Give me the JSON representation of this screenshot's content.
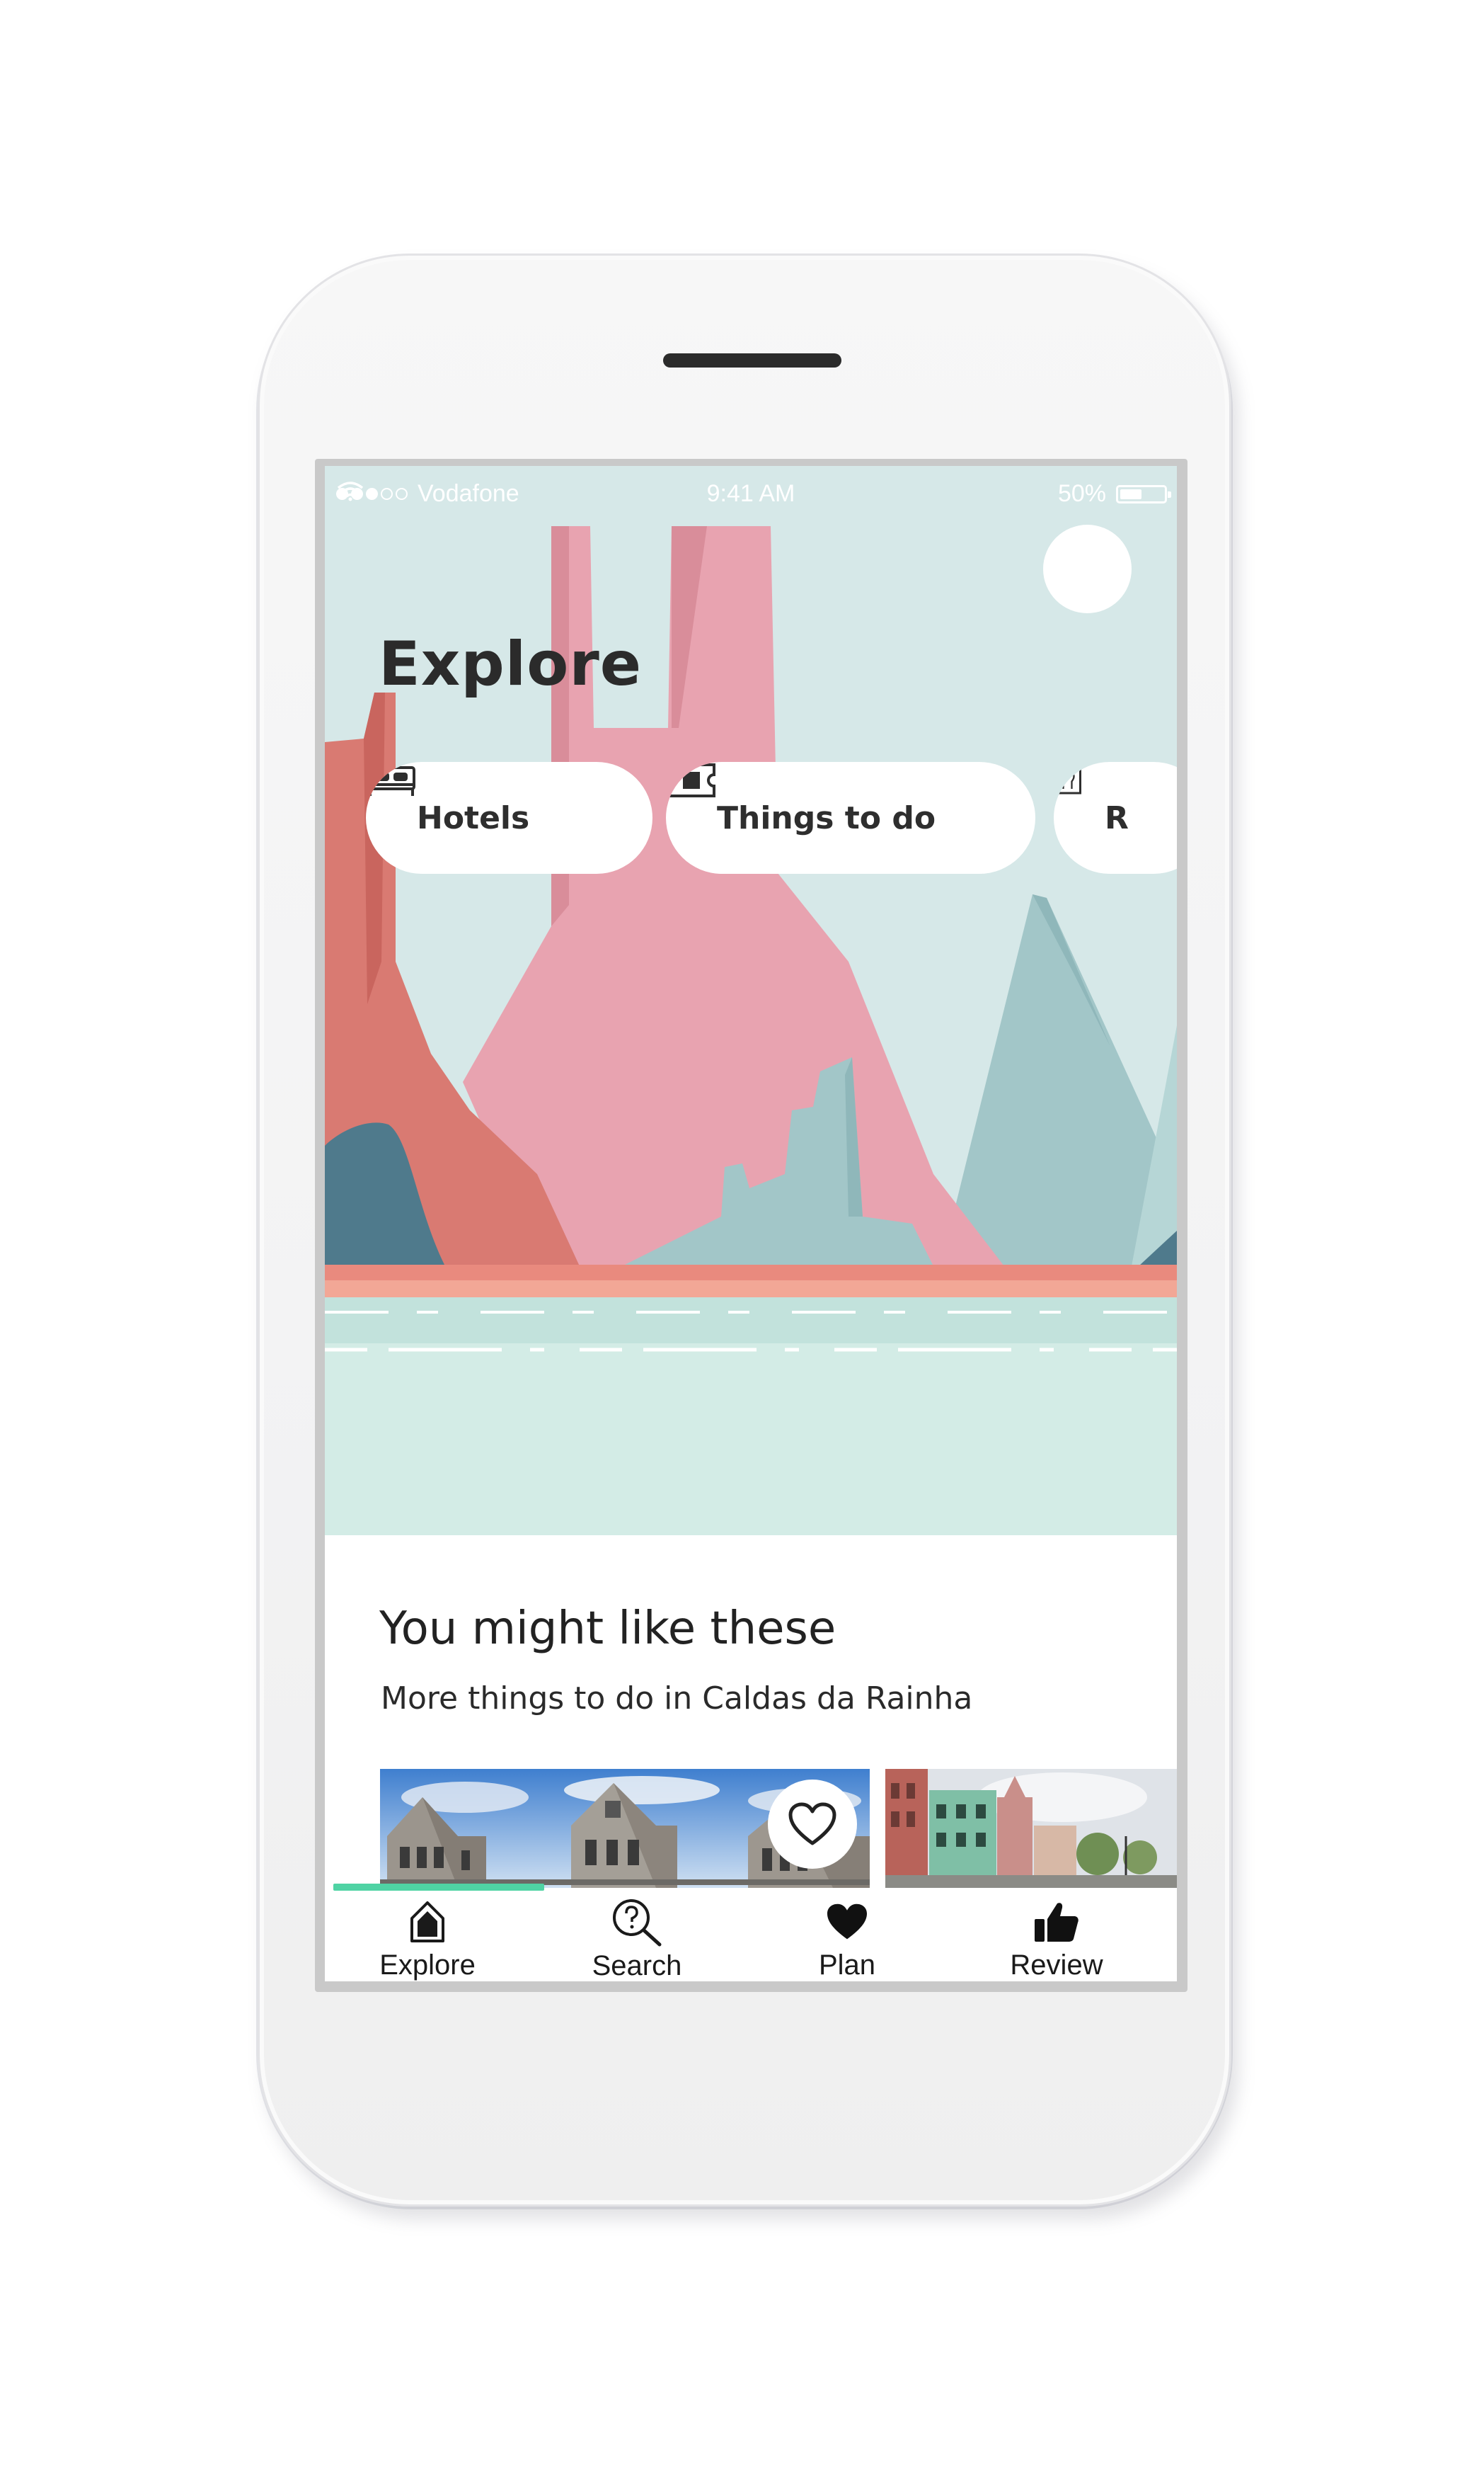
{
  "status_bar": {
    "carrier": "Vodafone",
    "time": "9:41 AM",
    "battery": "50%",
    "battery_level": 0.5
  },
  "hero": {
    "title": "Explore"
  },
  "categories": [
    {
      "label": "Hotels",
      "icon": "bed-icon"
    },
    {
      "label": "Things to do",
      "icon": "ticket-icon"
    },
    {
      "label": "R",
      "icon": "restaurant-icon"
    }
  ],
  "section": {
    "title": "You might like these",
    "subtitle": "More things to do in Caldas da Rainha"
  },
  "tabs": [
    {
      "label": "Explore",
      "icon": "home-icon",
      "active": true
    },
    {
      "label": "Search",
      "icon": "search-icon",
      "active": false
    },
    {
      "label": "Plan",
      "icon": "heart-icon",
      "active": false
    },
    {
      "label": "Review",
      "icon": "thumbs-up-icon",
      "active": false
    }
  ],
  "colors": {
    "accent": "#4fd3a4",
    "sky": "#d6e8e8",
    "mesa_pink": "#e8a3b0",
    "mesa_coral": "#d97a72",
    "teal_rock": "#a2c6c8",
    "water": "#d3ece6"
  }
}
